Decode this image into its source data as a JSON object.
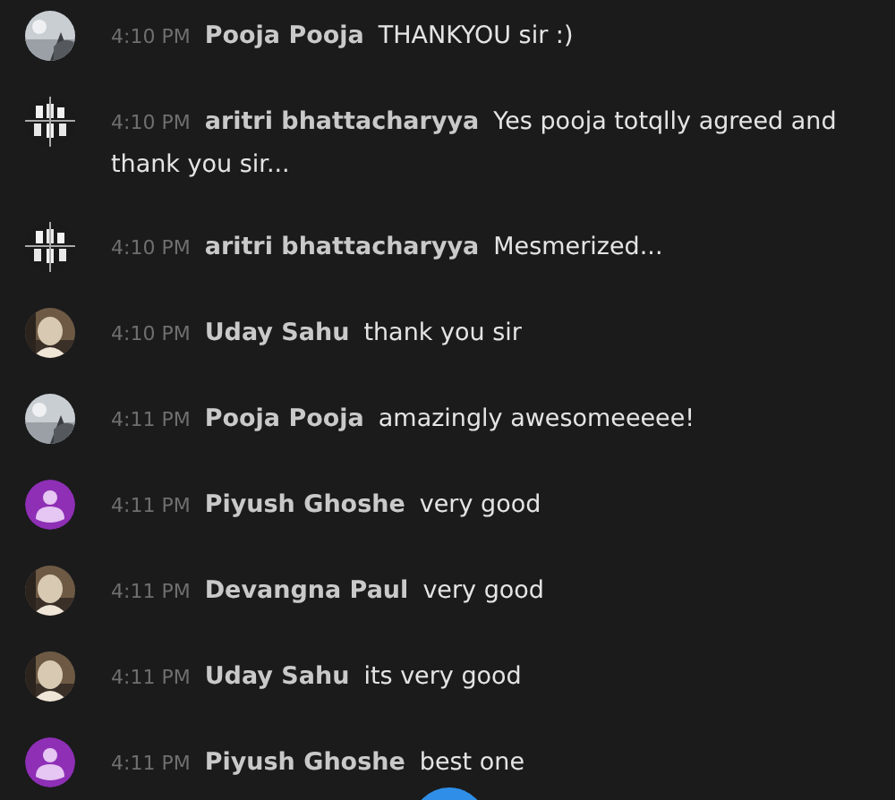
{
  "messages": [
    {
      "kind": "landscape",
      "time": "4:10 PM",
      "name": "Pooja Pooja",
      "lines": [
        "THANKYOU sir :)"
      ]
    },
    {
      "kind": "pattern",
      "time": "4:10 PM",
      "name": "aritri bhattacharyya",
      "lines": [
        "Yes pooja totqlly agreed and",
        "thank you sir..."
      ]
    },
    {
      "kind": "pattern",
      "time": "4:10 PM",
      "name": "aritri bhattacharyya",
      "lines": [
        "Mesmerized..."
      ]
    },
    {
      "kind": "portrait",
      "time": "4:10 PM",
      "name": "Uday Sahu",
      "lines": [
        "thank you sir"
      ]
    },
    {
      "kind": "landscape",
      "time": "4:11 PM",
      "name": "Pooja Pooja",
      "lines": [
        "amazingly awesomeeeee!"
      ]
    },
    {
      "kind": "default",
      "time": "4:11 PM",
      "name": "Piyush Ghoshe",
      "lines": [
        "very good"
      ]
    },
    {
      "kind": "portrait",
      "time": "4:11 PM",
      "name": "Devangna Paul",
      "lines": [
        "very good"
      ]
    },
    {
      "kind": "portrait",
      "time": "4:11 PM",
      "name": "Uday Sahu",
      "lines": [
        "its very good"
      ]
    },
    {
      "kind": "default",
      "time": "4:11 PM",
      "name": "Piyush Ghoshe",
      "lines": [
        "best one"
      ]
    }
  ]
}
